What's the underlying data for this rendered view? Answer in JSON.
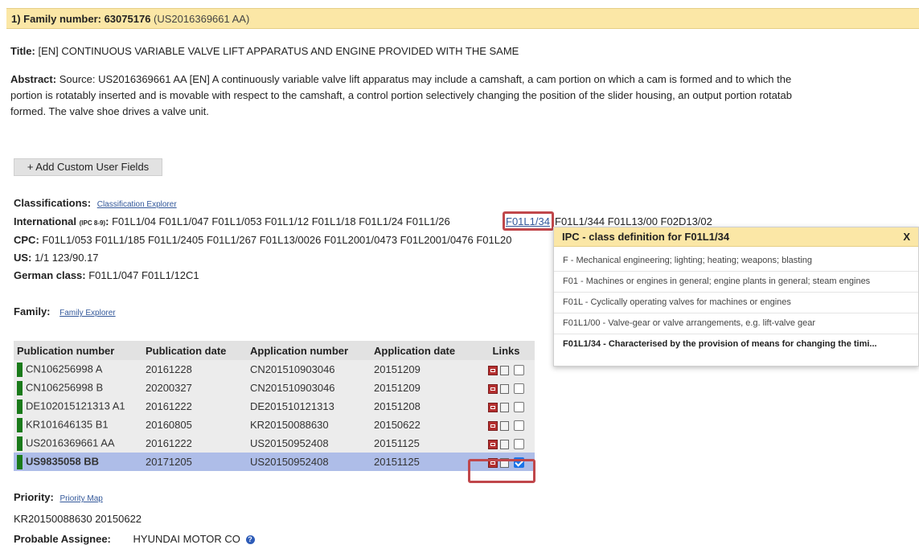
{
  "header": {
    "prefix": "1) Family number: 63075176",
    "ref": "(US2016369661 AA)"
  },
  "title": {
    "label": "Title:",
    "value": "[EN] CONTINUOUS VARIABLE VALVE LIFT APPARATUS AND ENGINE PROVIDED WITH THE SAME"
  },
  "abstract": {
    "label": "Abstract:",
    "line1": "Source: US2016369661 AA [EN] A continuously variable valve lift apparatus may include a camshaft, a cam portion on which a cam is formed and to which the",
    "line2": "portion is rotatably inserted and is movable with respect to the camshaft, a control portion selectively changing the position of the slider housing, an output portion rotatab",
    "line3": "formed. The valve shoe drives a valve unit."
  },
  "add_button": "+ Add Custom User Fields",
  "classifications": {
    "label": "Classifications:",
    "explorer_link": "Classification Explorer",
    "intl_label": "International",
    "intl_sub": "(IPC 8-9)",
    "intl_before": "F01L1/04 F01L1/047 F01L1/053 F01L1/12 F01L1/18 F01L1/24 F01L1/26",
    "intl_selected": "F01L1/34",
    "intl_after": "F01L1/344 F01L13/00 F02D13/02",
    "cpc_label": "CPC:",
    "cpc_value": "F01L1/053 F01L1/185 F01L1/2405 F01L1/267 F01L13/0026 F01L2001/0473 F01L2001/0476 F01L20",
    "us_label": "US:",
    "us_value": "1/1 123/90.17",
    "german_label": "German class:",
    "german_value": "F01L1/047 F01L1/12C1"
  },
  "popup": {
    "title": "IPC - class definition for F01L1/34",
    "close": "X",
    "items": [
      "F - Mechanical engineering; lighting; heating; weapons; blasting",
      "F01 - Machines or engines in general; engine plants in general; steam engines",
      "F01L - Cyclically operating valves for machines or engines",
      "F01L1/00 - Valve-gear or valve arrangements, e.g. lift-valve gear",
      "F01L1/34 - Characterised by the provision of means for changing the timi..."
    ]
  },
  "family": {
    "label": "Family:",
    "explorer_link": "Family Explorer",
    "columns": [
      "Publication number",
      "Publication date",
      "Application number",
      "Application date",
      "Links"
    ],
    "rows": [
      {
        "pub": "CN106256998 A",
        "pub_date": "20161228",
        "app": "CN201510903046",
        "app_date": "20151209",
        "checked": false
      },
      {
        "pub": "CN106256998 B",
        "pub_date": "20200327",
        "app": "CN201510903046",
        "app_date": "20151209",
        "checked": false
      },
      {
        "pub": "DE102015121313 A1",
        "pub_date": "20161222",
        "app": "DE201510121313",
        "app_date": "20151208",
        "checked": false
      },
      {
        "pub": "KR101646135 B1",
        "pub_date": "20160805",
        "app": "KR20150088630",
        "app_date": "20150622",
        "checked": false
      },
      {
        "pub": "US2016369661 AA",
        "pub_date": "20161222",
        "app": "US20150952408",
        "app_date": "20151125",
        "checked": false
      },
      {
        "pub": "US9835058 BB",
        "pub_date": "20171205",
        "app": "US20150952408",
        "app_date": "20151125",
        "checked": true
      }
    ]
  },
  "priority": {
    "label": "Priority:",
    "map_link": "Priority Map",
    "value": "KR20150088630 20150622"
  },
  "assignee": {
    "label": "Probable Assignee:",
    "value": "HYUNDAI MOTOR CO"
  },
  "colors": {
    "header_bg": "#fbe7a6",
    "selected_row": "#aebde8",
    "highlight_box": "#c0474b",
    "link": "#33589a",
    "status_green": "#1a7a1a"
  }
}
